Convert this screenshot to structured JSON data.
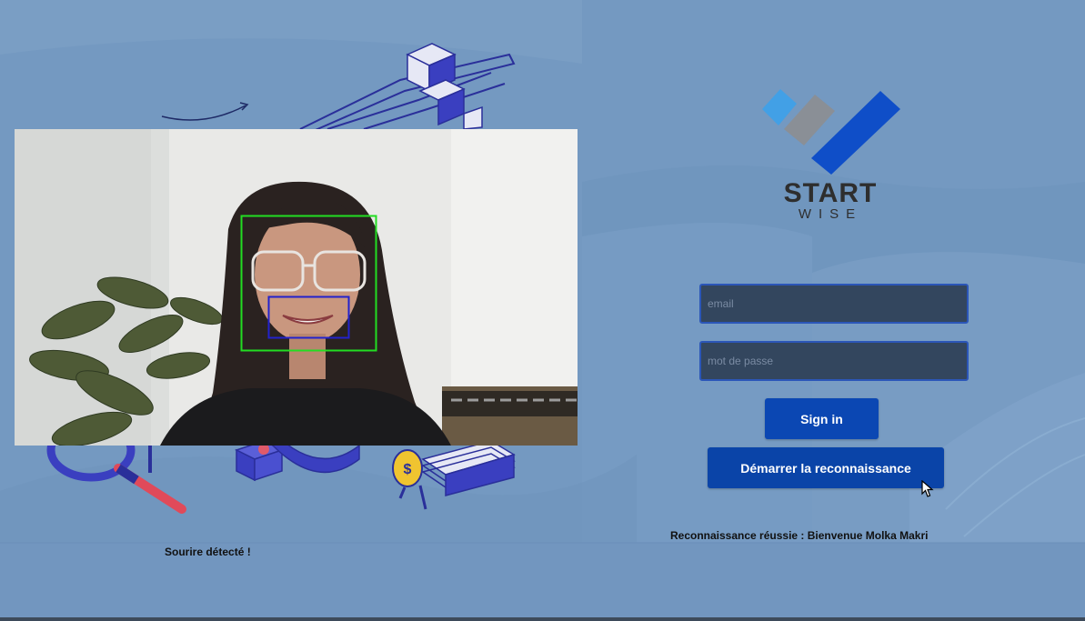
{
  "logo": {
    "word_top": "START",
    "word_bottom": "WISE",
    "colors": {
      "light_blue": "#42a0e6",
      "gray": "#8a8f96",
      "blue": "#0f4ec8"
    }
  },
  "login_form": {
    "email_placeholder": "email",
    "password_placeholder": "mot de passe",
    "sign_in_label": "Sign in",
    "start_recognition_label": "Démarrer la reconnaissance"
  },
  "status": {
    "recognition_message": "Reconnaissance réussie : Bienvenue Molka Makri",
    "smile_message": "Sourire détecté !"
  },
  "camera": {
    "face_box_color": "#22dd22",
    "smile_box_color": "#2222cc"
  },
  "colors": {
    "background": "#7498c0",
    "button": "#0b47b3",
    "field_background": "#33465e",
    "field_border": "#2b56b8"
  }
}
